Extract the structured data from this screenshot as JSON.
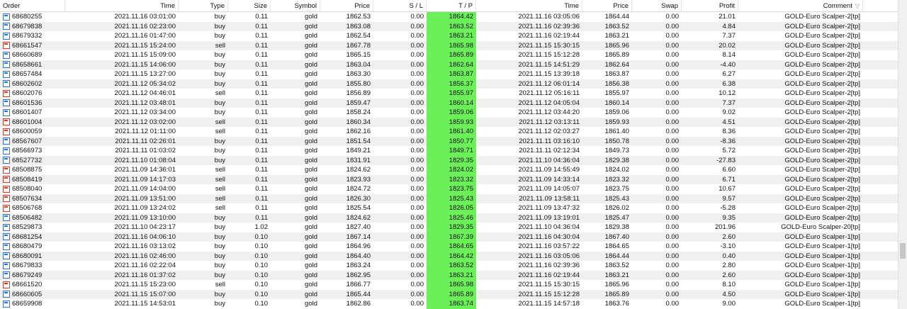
{
  "headers": {
    "order": "Order",
    "time": "Time",
    "type": "Type",
    "size": "Size",
    "symbol": "Symbol",
    "price": "Price",
    "sl": "S / L",
    "tp": "T / P",
    "close_time": "Time",
    "close_price": "Price",
    "swap": "Swap",
    "profit": "Profit",
    "comment": "Comment"
  },
  "sort_indicator": "▽",
  "colors": {
    "tp_highlight": "#6cf05a",
    "buy_icon": "#2f6fd6",
    "sell_icon": "#d23a2a"
  },
  "rows": [
    [
      "68680255",
      "2021.11.16 03:01:00",
      "buy",
      "0.11",
      "gold",
      "1862.53",
      "0.00",
      "1864.42",
      "2021.11.16 03:05:06",
      "1864.44",
      "0.00",
      "21.01",
      "GOLD-Euro Scalper-2[tp]"
    ],
    [
      "68679838",
      "2021.11.16 02:23:00",
      "buy",
      "0.11",
      "gold",
      "1863.08",
      "0.00",
      "1863.52",
      "2021.11.16 02:39:36",
      "1863.52",
      "0.00",
      "4.84",
      "GOLD-Euro Scalper-2[tp]"
    ],
    [
      "68679332",
      "2021.11.16 01:47:00",
      "buy",
      "0.11",
      "gold",
      "1862.54",
      "0.00",
      "1863.21",
      "2021.11.16 02:19:44",
      "1863.21",
      "0.00",
      "7.37",
      "GOLD-Euro Scalper-2[tp]"
    ],
    [
      "68661547",
      "2021.11.15 15:24:00",
      "sell",
      "0.11",
      "gold",
      "1867.78",
      "0.00",
      "1865.98",
      "2021.11.15 15:30:15",
      "1865.96",
      "0.00",
      "20.02",
      "GOLD-Euro Scalper-2[tp]"
    ],
    [
      "68660689",
      "2021.11.15 15:09:00",
      "buy",
      "0.11",
      "gold",
      "1865.15",
      "0.00",
      "1865.89",
      "2021.11.15 15:12:28",
      "1865.89",
      "0.00",
      "8.14",
      "GOLD-Euro Scalper-2[tp]"
    ],
    [
      "68658661",
      "2021.11.15 14:06:00",
      "buy",
      "0.11",
      "gold",
      "1863.04",
      "0.00",
      "1862.64",
      "2021.11.15 14:51:29",
      "1862.64",
      "0.00",
      "-4.40",
      "GOLD-Euro Scalper-2[tp]"
    ],
    [
      "68657484",
      "2021.11.15 13:27:00",
      "buy",
      "0.11",
      "gold",
      "1863.30",
      "0.00",
      "1863.87",
      "2021.11.15 13:39:18",
      "1863.87",
      "0.00",
      "6.27",
      "GOLD-Euro Scalper-2[tp]"
    ],
    [
      "68602602",
      "2021.11.12 05:34:02",
      "buy",
      "0.11",
      "gold",
      "1855.80",
      "0.00",
      "1856.37",
      "2021.11.12 06:01:14",
      "1856.38",
      "0.00",
      "6.38",
      "GOLD-Euro Scalper-2[tp]"
    ],
    [
      "68602076",
      "2021.11.12 04:46:01",
      "sell",
      "0.11",
      "gold",
      "1856.89",
      "0.00",
      "1855.97",
      "2021.11.12 05:16:11",
      "1855.97",
      "0.00",
      "10.12",
      "GOLD-Euro Scalper-2[tp]"
    ],
    [
      "68601536",
      "2021.11.12 03:48:01",
      "buy",
      "0.11",
      "gold",
      "1859.47",
      "0.00",
      "1860.14",
      "2021.11.12 04:05:04",
      "1860.14",
      "0.00",
      "7.37",
      "GOLD-Euro Scalper-2[tp]"
    ],
    [
      "68601407",
      "2021.11.12 03:34:00",
      "buy",
      "0.11",
      "gold",
      "1858.24",
      "0.00",
      "1859.06",
      "2021.11.12 03:44:20",
      "1859.06",
      "0.00",
      "9.02",
      "GOLD-Euro Scalper-2[tp]"
    ],
    [
      "68601004",
      "2021.11.12 03:02:00",
      "sell",
      "0.11",
      "gold",
      "1860.34",
      "0.00",
      "1859.93",
      "2021.11.12 03:13:11",
      "1859.93",
      "0.00",
      "4.51",
      "GOLD-Euro Scalper-2[tp]"
    ],
    [
      "68600059",
      "2021.11.12 01:11:00",
      "sell",
      "0.11",
      "gold",
      "1862.16",
      "0.00",
      "1861.40",
      "2021.11.12 02:03:27",
      "1861.40",
      "0.00",
      "8.36",
      "GOLD-Euro Scalper-2[tp]"
    ],
    [
      "68567607",
      "2021.11.11 02:26:01",
      "buy",
      "0.11",
      "gold",
      "1851.54",
      "0.00",
      "1850.77",
      "2021.11.11 03:16:10",
      "1850.78",
      "0.00",
      "-8.36",
      "GOLD-Euro Scalper-2[tp]"
    ],
    [
      "68566973",
      "2021.11.11 01:03:02",
      "buy",
      "0.11",
      "gold",
      "1849.21",
      "0.00",
      "1849.71",
      "2021.11.11 02:12:34",
      "1849.73",
      "0.00",
      "5.72",
      "GOLD-Euro Scalper-2[tp]"
    ],
    [
      "68527732",
      "2021.11.10 01:08:04",
      "buy",
      "0.11",
      "gold",
      "1831.91",
      "0.00",
      "1829.35",
      "2021.11.10 04:36:04",
      "1829.38",
      "0.00",
      "-27.83",
      "GOLD-Euro Scalper-2[tp]"
    ],
    [
      "68508875",
      "2021.11.09 14:36:01",
      "sell",
      "0.11",
      "gold",
      "1824.62",
      "0.00",
      "1824.02",
      "2021.11.09 14:55:49",
      "1824.02",
      "0.00",
      "6.60",
      "GOLD-Euro Scalper-2[tp]"
    ],
    [
      "68508419",
      "2021.11.09 14:17:03",
      "sell",
      "0.11",
      "gold",
      "1823.93",
      "0.00",
      "1823.32",
      "2021.11.09 14:33:14",
      "1823.32",
      "0.00",
      "6.71",
      "GOLD-Euro Scalper-2[tp]"
    ],
    [
      "68508040",
      "2021.11.09 14:04:00",
      "sell",
      "0.11",
      "gold",
      "1824.72",
      "0.00",
      "1823.75",
      "2021.11.09 14:05:07",
      "1823.75",
      "0.00",
      "10.67",
      "GOLD-Euro Scalper-2[tp]"
    ],
    [
      "68507634",
      "2021.11.09 13:51:00",
      "sell",
      "0.11",
      "gold",
      "1826.30",
      "0.00",
      "1825.43",
      "2021.11.09 13:58:11",
      "1825.43",
      "0.00",
      "9.57",
      "GOLD-Euro Scalper-2[tp]"
    ],
    [
      "68506768",
      "2021.11.09 13:24:02",
      "sell",
      "0.11",
      "gold",
      "1825.54",
      "0.00",
      "1826.05",
      "2021.11.09 13:47:32",
      "1826.02",
      "0.00",
      "-5.28",
      "GOLD-Euro Scalper-2[tp]"
    ],
    [
      "68506482",
      "2021.11.09 13:10:00",
      "buy",
      "0.11",
      "gold",
      "1824.62",
      "0.00",
      "1825.46",
      "2021.11.09 13:19:01",
      "1825.47",
      "0.00",
      "9.35",
      "GOLD-Euro Scalper-2[tp]"
    ],
    [
      "68529873",
      "2021.11.10 04:23:17",
      "buy",
      "1.02",
      "gold",
      "1827.40",
      "0.00",
      "1829.35",
      "2021.11.10 04:36:04",
      "1829.38",
      "0.00",
      "201.96",
      "GOLD-Euro Scalper-20[tp]"
    ],
    [
      "68681254",
      "2021.11.16 04:06:10",
      "buy",
      "0.10",
      "gold",
      "1867.14",
      "0.00",
      "1867.39",
      "2021.11.16 04:30:04",
      "1867.40",
      "0.00",
      "2.60",
      "GOLD-Euro Scalper-1[tp]"
    ],
    [
      "68680479",
      "2021.11.16 03:13:02",
      "buy",
      "0.10",
      "gold",
      "1864.96",
      "0.00",
      "1864.65",
      "2021.11.16 03:57:22",
      "1864.65",
      "0.00",
      "-3.10",
      "GOLD-Euro Scalper-1[tp]"
    ],
    [
      "68680091",
      "2021.11.16 02:46:00",
      "buy",
      "0.10",
      "gold",
      "1864.40",
      "0.00",
      "1864.42",
      "2021.11.16 03:05:06",
      "1864.44",
      "0.00",
      "0.40",
      "GOLD-Euro Scalper-1[tp]"
    ],
    [
      "68679833",
      "2021.11.16 02:22:04",
      "buy",
      "0.10",
      "gold",
      "1863.24",
      "0.00",
      "1863.52",
      "2021.11.16 02:39:36",
      "1863.52",
      "0.00",
      "2.80",
      "GOLD-Euro Scalper-1[tp]"
    ],
    [
      "68679249",
      "2021.11.16 01:37:02",
      "buy",
      "0.10",
      "gold",
      "1862.95",
      "0.00",
      "1863.21",
      "2021.11.16 02:19:44",
      "1863.21",
      "0.00",
      "2.60",
      "GOLD-Euro Scalper-1[tp]"
    ],
    [
      "68661520",
      "2021.11.15 15:23:00",
      "sell",
      "0.10",
      "gold",
      "1866.77",
      "0.00",
      "1865.98",
      "2021.11.15 15:30:15",
      "1865.96",
      "0.00",
      "8.10",
      "GOLD-Euro Scalper-1[tp]"
    ],
    [
      "68660605",
      "2021.11.15 15:07:00",
      "buy",
      "0.10",
      "gold",
      "1865.44",
      "0.00",
      "1865.89",
      "2021.11.15 15:12:28",
      "1865.89",
      "0.00",
      "4.50",
      "GOLD-Euro Scalper-1[tp]"
    ],
    [
      "68659908",
      "2021.11.15 14:53:01",
      "buy",
      "0.10",
      "gold",
      "1862.86",
      "0.00",
      "1863.74",
      "2021.11.15 14:57:18",
      "1863.76",
      "0.00",
      "9.00",
      "GOLD-Euro Scalper-1[tp]"
    ]
  ]
}
